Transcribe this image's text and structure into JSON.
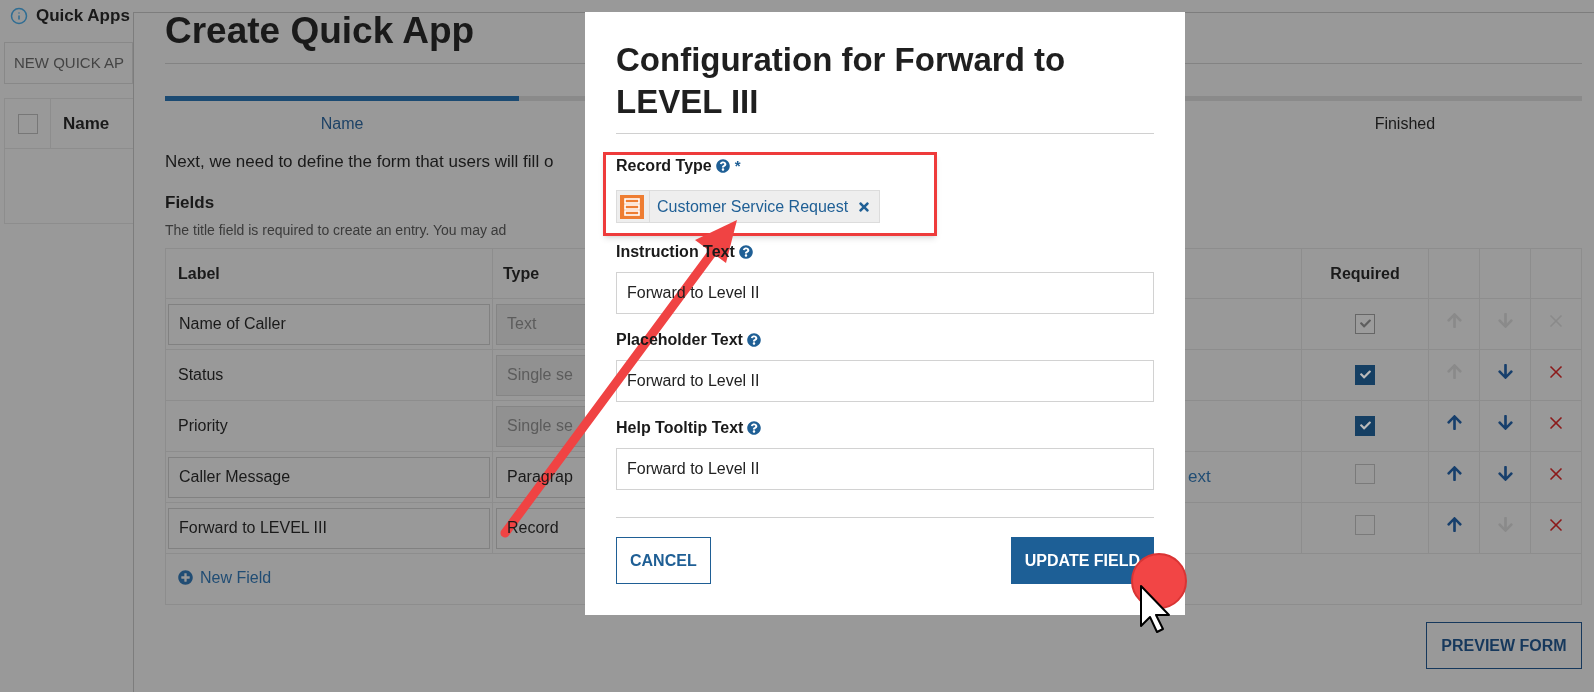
{
  "background_page": {
    "notice": "Quick Apps",
    "new_button": "NEW QUICK AP",
    "table": {
      "name_column": "Name",
      "select_all_checked": false
    }
  },
  "panel": {
    "title": "Create Quick App",
    "steps": [
      {
        "label": "Name",
        "done": true
      },
      {
        "label": "Finished",
        "done": false
      }
    ],
    "intro": "Next, we need to define the form that users will fill o",
    "fields_heading": "Fields",
    "fields_hint": "The title field is required to create an entry. You may ad",
    "table": {
      "columns": {
        "label": "Label",
        "type": "Type",
        "required": "Required"
      },
      "rows": [
        {
          "label": "Name of Caller",
          "kind": "input",
          "type": "Text",
          "type_disabled": true,
          "required": true,
          "required_disabled": true,
          "up_disabled": true,
          "down_disabled": true,
          "delete_disabled": true
        },
        {
          "label": "Status",
          "kind": "text",
          "type": "Single se",
          "type_disabled": true,
          "required": true,
          "required_disabled": false,
          "up_disabled": true,
          "down_disabled": false,
          "delete_disabled": false
        },
        {
          "label": "Priority",
          "kind": "text",
          "type": "Single se",
          "type_disabled": true,
          "required": true,
          "required_disabled": false,
          "up_disabled": false,
          "down_disabled": false,
          "delete_disabled": false
        },
        {
          "label": "Caller Message",
          "kind": "input",
          "type": "Paragrap",
          "type_disabled": false,
          "column_3": "ext",
          "required": false,
          "required_disabled": false,
          "up_disabled": false,
          "down_disabled": false,
          "delete_disabled": false
        },
        {
          "label": "Forward to LEVEL III",
          "kind": "input",
          "type": "Record",
          "type_disabled": false,
          "required": false,
          "required_disabled": false,
          "up_disabled": false,
          "down_disabled": true,
          "delete_disabled": false
        }
      ],
      "new_field": "New Field"
    },
    "preview_button": "PREVIEW FORM"
  },
  "modal": {
    "title": "Configuration for Forward to LEVEL III",
    "record_type": {
      "label": "Record Type",
      "required_mark": "*",
      "chip": "Customer Service Request"
    },
    "fields": [
      {
        "label": "Instruction Text",
        "value": "Forward to Level II"
      },
      {
        "label": "Placeholder Text",
        "value": "Forward to Level II"
      },
      {
        "label": "Help Tooltip Text",
        "value": "Forward to Level II"
      }
    ],
    "cancel_button": "CANCEL",
    "update_button": "UPDATE FIELD"
  }
}
